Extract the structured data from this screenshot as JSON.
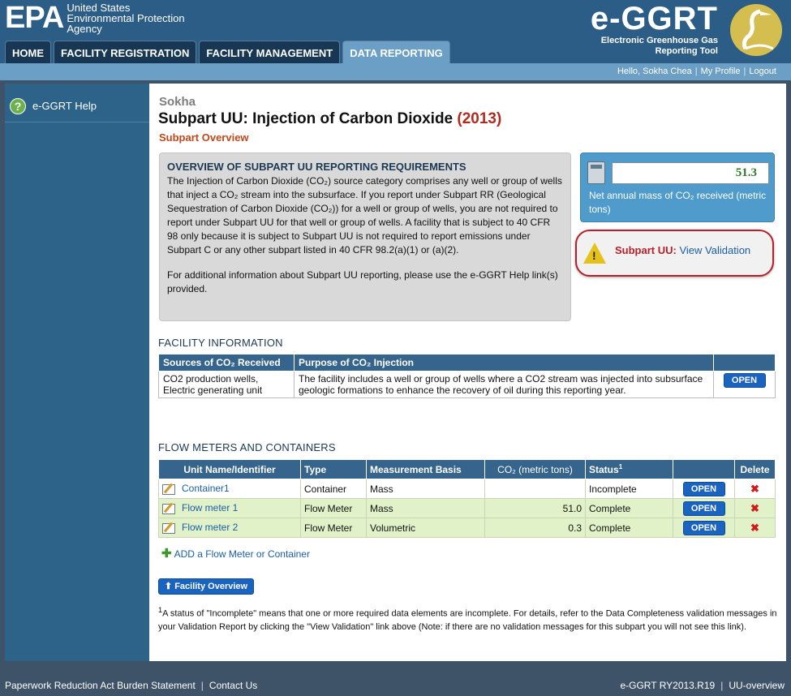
{
  "header": {
    "epa_mark": "EPA",
    "epa_lines": [
      "United States",
      "Environmental Protection",
      "Agency"
    ],
    "brand_title": "e-GGRT",
    "brand_sub": [
      "Electronic Greenhouse Gas",
      "Reporting Tool"
    ]
  },
  "nav": {
    "tabs": [
      {
        "label": "HOME",
        "active": false
      },
      {
        "label": "FACILITY REGISTRATION",
        "active": false
      },
      {
        "label": "FACILITY MANAGEMENT",
        "active": false
      },
      {
        "label": "DATA REPORTING",
        "active": true
      }
    ]
  },
  "user": {
    "greeting": "Hello, Sokha Chea",
    "profile": "My Profile",
    "logout": "Logout"
  },
  "sidebar": {
    "help_label": "e-GGRT Help"
  },
  "page": {
    "facility": "Sokha",
    "title_main": "Subpart UU: Injection of Carbon Dioxide",
    "title_year": "(2013)",
    "subtitle": "Subpart Overview"
  },
  "overview": {
    "heading": "OVERVIEW OF SUBPART UU REPORTING REQUIREMENTS",
    "para1": "The Injection of Carbon Dioxide (CO₂) source category comprises any well or group of wells that inject a CO₂ stream into the subsurface. If you report under Subpart RR (Geological Sequestration of Carbon Dioxide (CO₂)) for a well or group of wells, you are not required to report under Subpart UU for that well or group of wells. A facility that is subject to 40 CFR 98 only because it is subject to Subpart UU is not required to report emissions under Subpart C or any other subpart listed in 40 CFR 98.2(a)(1) or (a)(2).",
    "para2": "For additional information about Subpart UU reporting, please use the e-GGRT Help link(s) provided."
  },
  "metric": {
    "value": "51.3",
    "label": "Net annual mass of CO₂ received (metric tons)"
  },
  "validation": {
    "prefix": "Subpart UU:",
    "link": "View Validation"
  },
  "facility_info": {
    "title": "FACILITY INFORMATION",
    "headers": [
      "Sources of CO₂ Received",
      "Purpose of CO₂ Injection",
      ""
    ],
    "row": {
      "sources": "CO2 production wells, Electric generating unit",
      "purpose": "The facility includes a well or group of wells where a CO2 stream was injected into subsurface geologic formations to enhance the recovery of oil during this reporting year.",
      "action": "OPEN"
    }
  },
  "flow": {
    "title": "FLOW METERS AND CONTAINERS",
    "headers": [
      "Unit Name/Identifier",
      "Type",
      "Measurement Basis",
      "CO₂ (metric tons)",
      "Status",
      "",
      "Delete"
    ],
    "status_sup": "1",
    "rows": [
      {
        "name": "Container1",
        "type": "Container",
        "basis": "Mass",
        "co2": "",
        "status": "Incomplete",
        "action": "OPEN"
      },
      {
        "name": "Flow meter 1",
        "type": "Flow Meter",
        "basis": "Mass",
        "co2": "51.0",
        "status": "Complete",
        "action": "OPEN"
      },
      {
        "name": "Flow meter 2",
        "type": "Flow Meter",
        "basis": "Volumetric",
        "co2": "0.3",
        "status": "Complete",
        "action": "OPEN"
      }
    ],
    "add_label": "ADD a Flow Meter or Container"
  },
  "facility_overview_btn": "Facility Overview",
  "footnote": {
    "sup": "1",
    "text": "A status of \"Incomplete\" means that one or more required data elements are incomplete. For details, refer to the Data Completeness validation messages in your Validation Report by clicking the \"View Validation\" link above (Note: if there are no validation messages for this subpart you will not see this link)."
  },
  "footer": {
    "paperwork": "Paperwork Reduction Act Burden Statement",
    "contact": "Contact Us",
    "version": "e-GGRT RY2013.R19",
    "page_id": "UU-overview"
  }
}
